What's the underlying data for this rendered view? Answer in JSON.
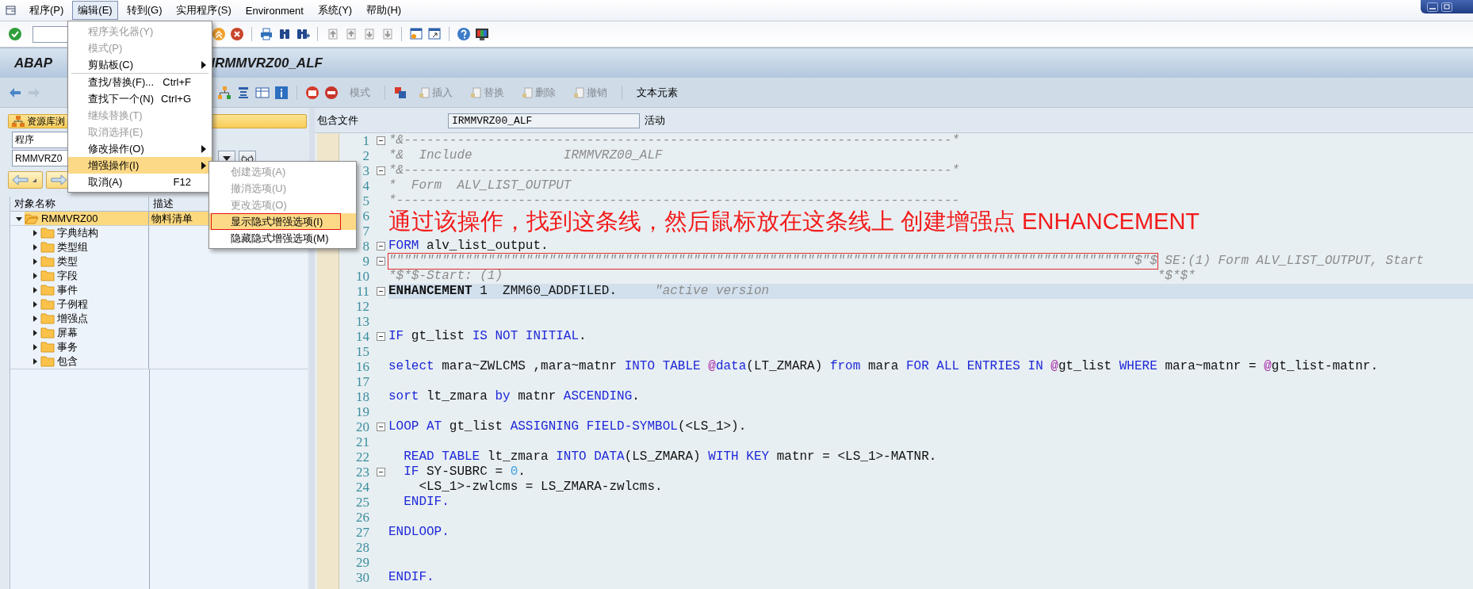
{
  "menubar": [
    {
      "label": "程序(P)",
      "selected": false
    },
    {
      "label": "编辑(E)",
      "selected": true
    },
    {
      "label": "转到(G)",
      "selected": false
    },
    {
      "label": "实用程序(S)",
      "selected": false
    },
    {
      "label": "Environment",
      "selected": false
    },
    {
      "label": "系统(Y)",
      "selected": false
    },
    {
      "label": "帮助(H)",
      "selected": false
    }
  ],
  "title_left": "ABAP",
  "title_right": "IRMMVRZ00_ALF",
  "app_toolbar": [
    {
      "label": "模式",
      "kind": "text",
      "disabled": true
    },
    {
      "label": "插入",
      "kind": "icon_text",
      "disabled": true
    },
    {
      "label": "替换",
      "kind": "icon_text",
      "disabled": true
    },
    {
      "label": "删除",
      "kind": "icon_text",
      "disabled": true
    },
    {
      "label": "撤销",
      "kind": "icon_text",
      "disabled": true
    },
    {
      "label": "文本元素",
      "kind": "text",
      "disabled": false
    }
  ],
  "repository": {
    "title": "资源库浏",
    "object_type": "程序",
    "object_name": "RMMVRZ0"
  },
  "tree": {
    "columns": [
      "对象名称",
      "描述"
    ],
    "rows": [
      {
        "label": "RMMVRZ00",
        "description": "物料清单",
        "expanded": true,
        "selected": true,
        "children": [
          {
            "label": "字典结构",
            "expanded": false,
            "selected": false
          },
          {
            "label": "类型组",
            "expanded": false,
            "selected": false
          },
          {
            "label": "类型",
            "expanded": false,
            "selected": false
          },
          {
            "label": "字段",
            "expanded": false,
            "selected": false
          },
          {
            "label": "事件",
            "expanded": false,
            "selected": false
          },
          {
            "label": "子例程",
            "expanded": false,
            "selected": false
          },
          {
            "label": "增强点",
            "expanded": false,
            "selected": false
          },
          {
            "label": "屏幕",
            "expanded": false,
            "selected": false
          },
          {
            "label": "事务",
            "expanded": false,
            "selected": false
          },
          {
            "label": "包含",
            "expanded": false,
            "selected": false
          }
        ]
      }
    ]
  },
  "editor": {
    "label": "包含文件",
    "include": "IRMMVRZ00_ALF",
    "status": "活动",
    "lines": [
      {
        "no": "1",
        "fold": true,
        "current": false,
        "segs": [
          {
            "t": "*&------------------------------------------------------------------------*",
            "kind": "cmt"
          }
        ]
      },
      {
        "no": "2",
        "fold": false,
        "current": false,
        "segs": [
          {
            "t": "*&  Include            IRMMVRZ00_ALF",
            "kind": "cmt"
          }
        ]
      },
      {
        "no": "3",
        "fold": true,
        "current": false,
        "segs": [
          {
            "t": "*&------------------------------------------------------------------------*",
            "kind": "cmt"
          }
        ]
      },
      {
        "no": "4",
        "fold": false,
        "current": false,
        "segs": [
          {
            "t": "*  Form  ALV_LIST_OUTPUT",
            "kind": "cmt"
          }
        ]
      },
      {
        "no": "5",
        "fold": false,
        "current": false,
        "segs": [
          {
            "t": "*--------------------------------------------------------------------------",
            "kind": "cmt"
          }
        ]
      },
      {
        "no": "6",
        "fold": false,
        "current": false
      },
      {
        "no": "7",
        "fold": false,
        "current": false
      },
      {
        "no": "8",
        "fold": true,
        "current": false,
        "segs": [
          {
            "t": "FORM",
            "kind": "kw"
          },
          {
            "t": " alv_list_output.",
            "kind": "plain"
          }
        ]
      },
      {
        "no": "9",
        "fold": true,
        "current": false,
        "segs": [
          {
            "t": "\"\"\"\"\"\"\"\"\"\"\"\"\"\"\"\"\"\"\"\"\"\"\"\"\"\"\"\"\"\"\"\"\"\"\"\"\"\"\"\"\"\"\"\"\"\"\"\"\"\"\"\"\"\"\"\"\"\"\"\"\"\"\"\"\"\"\"\"\"\"\"\"\"\"\"\"\"\"\"\"\"\"\"\"\"\"\"\"\"\"\"\"\"\"\"\"\"\"$\"$",
            "kind": "cmt",
            "marked": true
          },
          {
            "t": " SE:(1) Form ALV_LIST_OUTPUT, Start",
            "kind": "cmt",
            "marked": false
          }
        ]
      },
      {
        "no": "10",
        "fold": false,
        "current": false,
        "segs": [
          {
            "t": "*$*$-Start: (1)                                                                                      *$*$*",
            "kind": "cmt"
          }
        ]
      },
      {
        "no": "11",
        "fold": true,
        "current": true,
        "segs": [
          {
            "t": "ENHANCEMENT",
            "kind": "bold"
          },
          {
            "t": " 1  ZMM60_ADDFILED.     ",
            "kind": "plain"
          },
          {
            "t": "\"active version",
            "kind": "cmt"
          }
        ]
      },
      {
        "no": "12",
        "fold": false,
        "current": false
      },
      {
        "no": "13",
        "fold": false,
        "current": false
      },
      {
        "no": "14",
        "fold": true,
        "current": false,
        "segs": [
          {
            "t": "IF",
            "kind": "kw"
          },
          {
            "t": " gt_list ",
            "kind": "plain"
          },
          {
            "t": "IS NOT INITIAL",
            "kind": "kw"
          },
          {
            "t": ".",
            "kind": "plain"
          }
        ]
      },
      {
        "no": "15",
        "fold": false,
        "current": false
      },
      {
        "no": "16",
        "fold": false,
        "current": false,
        "segs": [
          {
            "t": "select",
            "kind": "kw"
          },
          {
            "t": " mara~ZWLCMS ,mara~matnr ",
            "kind": "plain"
          },
          {
            "t": "INTO TABLE",
            "kind": "kw"
          },
          {
            "t": " @",
            "kind": "at"
          },
          {
            "t": "data",
            "kind": "kw"
          },
          {
            "t": "(LT_ZMARA) ",
            "kind": "plain"
          },
          {
            "t": "from",
            "kind": "kw"
          },
          {
            "t": " mara ",
            "kind": "plain"
          },
          {
            "t": "FOR ALL ENTRIES IN",
            "kind": "kw"
          },
          {
            "t": " @",
            "kind": "at"
          },
          {
            "t": "gt_list ",
            "kind": "plain"
          },
          {
            "t": "WHERE",
            "kind": "kw"
          },
          {
            "t": " mara~matnr = ",
            "kind": "plain"
          },
          {
            "t": "@",
            "kind": "at"
          },
          {
            "t": "gt_list-matnr.",
            "kind": "plain"
          }
        ]
      },
      {
        "no": "17",
        "fold": false,
        "current": false
      },
      {
        "no": "18",
        "fold": false,
        "current": false,
        "segs": [
          {
            "t": "sort",
            "kind": "kw"
          },
          {
            "t": " lt_zmara ",
            "kind": "plain"
          },
          {
            "t": "by",
            "kind": "kw"
          },
          {
            "t": " matnr ",
            "kind": "plain"
          },
          {
            "t": "ASCENDING",
            "kind": "kw"
          },
          {
            "t": ".",
            "kind": "plain"
          }
        ]
      },
      {
        "no": "19",
        "fold": false,
        "current": false
      },
      {
        "no": "20",
        "fold": true,
        "current": false,
        "segs": [
          {
            "t": "LOOP AT",
            "kind": "kw"
          },
          {
            "t": " gt_list ",
            "kind": "plain"
          },
          {
            "t": "ASSIGNING FIELD-SYMBOL",
            "kind": "kw"
          },
          {
            "t": "(<LS_1>).",
            "kind": "plain"
          }
        ]
      },
      {
        "no": "21",
        "fold": false,
        "current": false
      },
      {
        "no": "22",
        "fold": false,
        "current": false,
        "segs": [
          {
            "t": "  READ TABLE",
            "kind": "kw"
          },
          {
            "t": " lt_zmara ",
            "kind": "plain"
          },
          {
            "t": "INTO DATA",
            "kind": "kw"
          },
          {
            "t": "(LS_ZMARA) ",
            "kind": "plain"
          },
          {
            "t": "WITH KEY",
            "kind": "kw"
          },
          {
            "t": " matnr = <LS_1>-MATNR.",
            "kind": "plain"
          }
        ]
      },
      {
        "no": "23",
        "fold": true,
        "current": false,
        "segs": [
          {
            "t": "  IF",
            "kind": "kw"
          },
          {
            "t": " SY-SUBRC = ",
            "kind": "plain"
          },
          {
            "t": "0",
            "kind": "num"
          },
          {
            "t": ".",
            "kind": "plain"
          }
        ]
      },
      {
        "no": "24",
        "fold": false,
        "current": false,
        "segs": [
          {
            "t": "    <LS_1>-zwlcms = LS_ZMARA-zwlcms.",
            "kind": "plain"
          }
        ]
      },
      {
        "no": "25",
        "fold": false,
        "current": false,
        "segs": [
          {
            "t": "  ENDIF.",
            "kind": "kw"
          }
        ]
      },
      {
        "no": "26",
        "fold": false,
        "current": false
      },
      {
        "no": "27",
        "fold": false,
        "current": false,
        "segs": [
          {
            "t": "ENDLOOP.",
            "kind": "kw"
          }
        ]
      },
      {
        "no": "28",
        "fold": false,
        "current": false
      },
      {
        "no": "29",
        "fold": false,
        "current": false
      },
      {
        "no": "30",
        "fold": false,
        "current": false,
        "segs": [
          {
            "t": "ENDIF.",
            "kind": "kw"
          }
        ]
      }
    ]
  },
  "edit_menu": {
    "items": [
      {
        "kind": "item",
        "label": "程序美化器(Y)",
        "disabled": true,
        "selected": false
      },
      {
        "kind": "item",
        "label": "模式(P)",
        "disabled": true,
        "selected": false
      },
      {
        "kind": "item",
        "label": "剪贴板(C)",
        "disabled": false,
        "selected": false,
        "has_submenu": true
      },
      {
        "kind": "separator"
      },
      {
        "kind": "item",
        "label": "查找/替换(F)...",
        "shortcut": "Ctrl+F",
        "disabled": false,
        "selected": false
      },
      {
        "kind": "item",
        "label": "查找下一个(N)",
        "shortcut": "Ctrl+G",
        "disabled": false,
        "selected": false
      },
      {
        "kind": "item",
        "label": "继续替换(T)",
        "disabled": true,
        "selected": false
      },
      {
        "kind": "item",
        "label": "取消选择(E)",
        "disabled": true,
        "selected": false
      },
      {
        "kind": "item",
        "label": "修改操作(O)",
        "disabled": false,
        "selected": false,
        "has_submenu": true
      },
      {
        "kind": "item",
        "label": "增强操作(I)",
        "disabled": false,
        "selected": true,
        "has_submenu": true
      },
      {
        "kind": "item",
        "label": "取消(A)",
        "shortcut": "F12",
        "disabled": false,
        "selected": false
      }
    ]
  },
  "submenu": {
    "items": [
      {
        "kind": "item",
        "label": "创建选项(A)",
        "disabled": true,
        "selected": false,
        "marked": false
      },
      {
        "kind": "item",
        "label": "撤消选项(U)",
        "disabled": true,
        "selected": false,
        "marked": false
      },
      {
        "kind": "item",
        "label": "更改选项(O)",
        "disabled": true,
        "selected": false,
        "marked": false
      },
      {
        "kind": "item",
        "label": "显示隐式增强选项(I)",
        "disabled": false,
        "selected": true,
        "marked": true
      },
      {
        "kind": "item",
        "label": "隐藏隐式增强选项(M)",
        "disabled": false,
        "selected": false,
        "marked": false
      }
    ]
  },
  "annotation": "通过该操作，找到这条线，然后鼠标放在这条线上 创建增强点 ENHANCEMENT"
}
